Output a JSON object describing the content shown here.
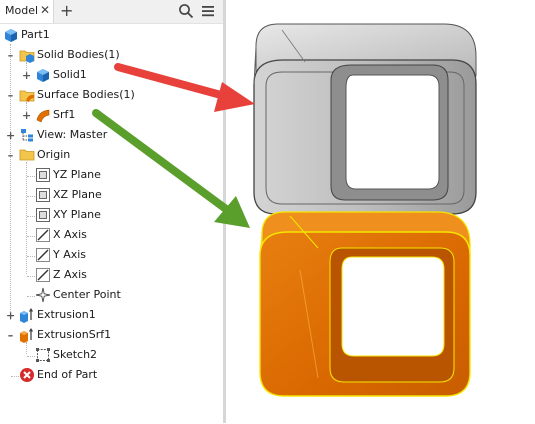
{
  "browser": {
    "tab_label": "Model",
    "close_glyph": "✕",
    "add_glyph": "+",
    "toolbar_icons": [
      "search-icon",
      "menu-icon"
    ],
    "items": [
      {
        "label": "Part1",
        "icon": "part-icon"
      },
      {
        "label": "Solid Bodies(1)",
        "icon": "solid-bodies-folder-icon"
      },
      {
        "label": "Solid1",
        "icon": "solid-body-icon"
      },
      {
        "label": "Surface Bodies(1)",
        "icon": "surface-bodies-folder-icon"
      },
      {
        "label": "Srf1",
        "icon": "surface-body-icon"
      },
      {
        "label": "View: Master",
        "icon": "view-rep-icon"
      },
      {
        "label": "Origin",
        "icon": "origin-folder-icon"
      },
      {
        "label": "YZ Plane",
        "icon": "plane-icon"
      },
      {
        "label": "XZ Plane",
        "icon": "plane-icon"
      },
      {
        "label": "XY Plane",
        "icon": "plane-icon"
      },
      {
        "label": "X Axis",
        "icon": "axis-icon"
      },
      {
        "label": "Y Axis",
        "icon": "axis-icon"
      },
      {
        "label": "Z Axis",
        "icon": "axis-icon"
      },
      {
        "label": "Center Point",
        "icon": "center-point-icon"
      },
      {
        "label": "Extrusion1",
        "icon": "extrusion-icon"
      },
      {
        "label": "ExtrusionSrf1",
        "icon": "surface-extrusion-icon"
      },
      {
        "label": "Sketch2",
        "icon": "sketch-icon"
      },
      {
        "label": "End of Part",
        "icon": "end-of-part-icon"
      }
    ]
  },
  "graphics": {
    "solid_color": "#c8c8c8",
    "surface_color": "#e07000",
    "surface_edge_color": "#f5e600",
    "red_arrow_color": "#e8403a",
    "green_arrow_color": "#5a9e2c"
  }
}
